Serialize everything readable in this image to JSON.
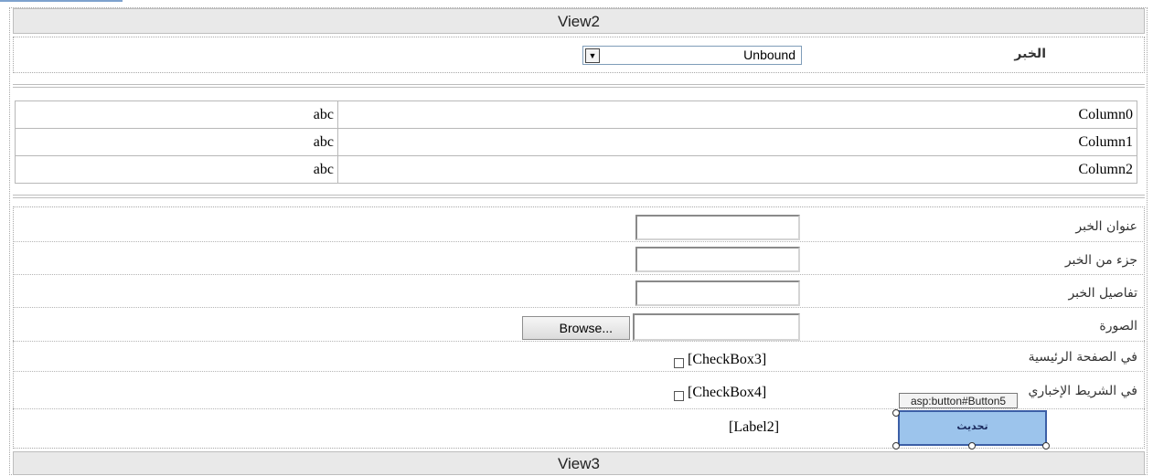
{
  "views": {
    "view2_label": "View2",
    "view3_label": "View3"
  },
  "news_picker": {
    "label": "الخبر",
    "selected": "Unbound"
  },
  "grid": {
    "rows": [
      {
        "column": "Column0",
        "value": "abc"
      },
      {
        "column": "Column1",
        "value": "abc"
      },
      {
        "column": "Column2",
        "value": "abc"
      }
    ]
  },
  "form": {
    "title_label": "عنوان الخبر",
    "excerpt_label": "جزء من الخبر",
    "details_label": "تفاصيل الخبر",
    "image_label": "الصورة",
    "browse_label": "Browse...",
    "homepage_label": "في الصفحة الرئيسية",
    "ticker_label": "في الشريط الإخباري",
    "checkbox3": "[CheckBox3]",
    "checkbox4": "[CheckBox4]",
    "label2": "[Label2]",
    "update_button": "تحديث",
    "button_tag": "asp:button#Button5"
  }
}
